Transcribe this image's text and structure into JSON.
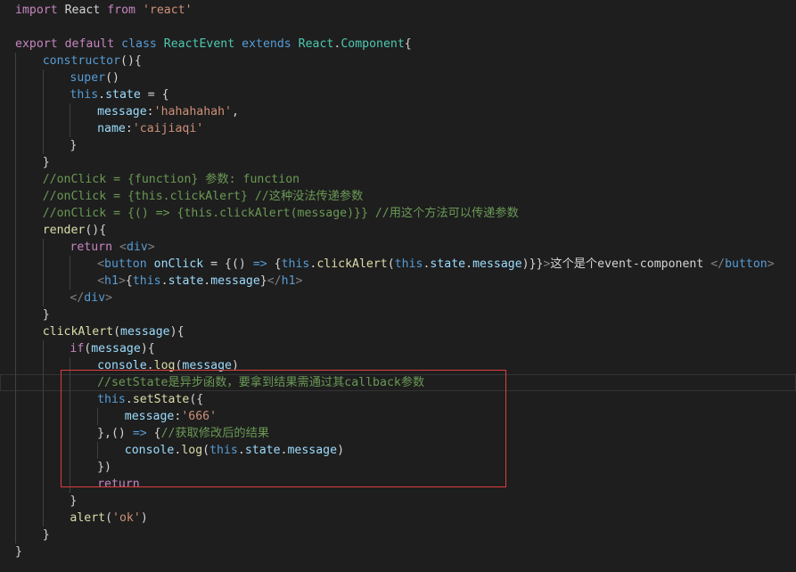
{
  "theme": {
    "background": "#1e1e1e",
    "annotation_color": "#e03c3c"
  },
  "lines": [
    {
      "indent": 0,
      "tokens": [
        {
          "t": "import",
          "c": "kw"
        },
        {
          "t": " React ",
          "c": "plain"
        },
        {
          "t": "from",
          "c": "kw"
        },
        {
          "t": " ",
          "c": "plain"
        },
        {
          "t": "'react'",
          "c": "str"
        }
      ]
    },
    {
      "indent": 0,
      "tokens": []
    },
    {
      "indent": 0,
      "tokens": [
        {
          "t": "export",
          "c": "kw"
        },
        {
          "t": " ",
          "c": "plain"
        },
        {
          "t": "default",
          "c": "kw"
        },
        {
          "t": " ",
          "c": "plain"
        },
        {
          "t": "class",
          "c": "kw2"
        },
        {
          "t": " ",
          "c": "plain"
        },
        {
          "t": "ReactEvent",
          "c": "cls"
        },
        {
          "t": " ",
          "c": "plain"
        },
        {
          "t": "extends",
          "c": "kw2"
        },
        {
          "t": " ",
          "c": "plain"
        },
        {
          "t": "React",
          "c": "cls"
        },
        {
          "t": ".",
          "c": "pun"
        },
        {
          "t": "Component",
          "c": "cls"
        },
        {
          "t": "{",
          "c": "pun"
        }
      ]
    },
    {
      "indent": 1,
      "tokens": [
        {
          "t": "constructor",
          "c": "kw2"
        },
        {
          "t": "(){",
          "c": "pun"
        }
      ]
    },
    {
      "indent": 2,
      "tokens": [
        {
          "t": "super",
          "c": "kw2"
        },
        {
          "t": "()",
          "c": "pun"
        }
      ]
    },
    {
      "indent": 2,
      "tokens": [
        {
          "t": "this",
          "c": "kw2"
        },
        {
          "t": ".",
          "c": "pun"
        },
        {
          "t": "state",
          "c": "var"
        },
        {
          "t": " = {",
          "c": "pun"
        }
      ]
    },
    {
      "indent": 3,
      "tokens": [
        {
          "t": "message",
          "c": "var"
        },
        {
          "t": ":",
          "c": "pun"
        },
        {
          "t": "'hahahahah'",
          "c": "str"
        },
        {
          "t": ",",
          "c": "pun"
        }
      ]
    },
    {
      "indent": 3,
      "tokens": [
        {
          "t": "name",
          "c": "var"
        },
        {
          "t": ":",
          "c": "pun"
        },
        {
          "t": "'caijiaqi'",
          "c": "str"
        }
      ]
    },
    {
      "indent": 2,
      "tokens": [
        {
          "t": "}",
          "c": "pun"
        }
      ]
    },
    {
      "indent": 1,
      "tokens": [
        {
          "t": "}",
          "c": "pun"
        }
      ]
    },
    {
      "indent": 1,
      "tokens": [
        {
          "t": "//onClick = {function} 参数: function",
          "c": "cmt"
        }
      ]
    },
    {
      "indent": 1,
      "tokens": [
        {
          "t": "//onClick = {this.clickAlert} //这种没法传递参数",
          "c": "cmt"
        }
      ]
    },
    {
      "indent": 1,
      "tokens": [
        {
          "t": "//onClick = {() => {this.clickAlert(message)}} //用这个方法可以传递参数",
          "c": "cmt"
        }
      ]
    },
    {
      "indent": 1,
      "tokens": [
        {
          "t": "render",
          "c": "fn"
        },
        {
          "t": "(){",
          "c": "pun"
        }
      ]
    },
    {
      "indent": 2,
      "tokens": [
        {
          "t": "return",
          "c": "kw"
        },
        {
          "t": " ",
          "c": "plain"
        },
        {
          "t": "<",
          "c": "ang"
        },
        {
          "t": "div",
          "c": "tag"
        },
        {
          "t": ">",
          "c": "ang"
        }
      ]
    },
    {
      "indent": 3,
      "tokens": [
        {
          "t": "<",
          "c": "ang"
        },
        {
          "t": "button",
          "c": "tag"
        },
        {
          "t": " ",
          "c": "plain"
        },
        {
          "t": "onClick",
          "c": "var"
        },
        {
          "t": " = {",
          "c": "pun"
        },
        {
          "t": "()",
          "c": "pun"
        },
        {
          "t": " ",
          "c": "plain"
        },
        {
          "t": "=>",
          "c": "kw2"
        },
        {
          "t": " {",
          "c": "pun"
        },
        {
          "t": "this",
          "c": "kw2"
        },
        {
          "t": ".",
          "c": "pun"
        },
        {
          "t": "clickAlert",
          "c": "fn"
        },
        {
          "t": "(",
          "c": "pun"
        },
        {
          "t": "this",
          "c": "kw2"
        },
        {
          "t": ".",
          "c": "pun"
        },
        {
          "t": "state",
          "c": "var"
        },
        {
          "t": ".",
          "c": "pun"
        },
        {
          "t": "message",
          "c": "var"
        },
        {
          "t": ")}}",
          "c": "pun"
        },
        {
          "t": ">",
          "c": "ang"
        },
        {
          "t": "这个是个event-component ",
          "c": "txt"
        },
        {
          "t": "</",
          "c": "ang"
        },
        {
          "t": "button",
          "c": "tag"
        },
        {
          "t": ">",
          "c": "ang"
        }
      ]
    },
    {
      "indent": 3,
      "tokens": [
        {
          "t": "<",
          "c": "ang"
        },
        {
          "t": "h1",
          "c": "tag"
        },
        {
          "t": ">",
          "c": "ang"
        },
        {
          "t": "{",
          "c": "pun"
        },
        {
          "t": "this",
          "c": "kw2"
        },
        {
          "t": ".",
          "c": "pun"
        },
        {
          "t": "state",
          "c": "var"
        },
        {
          "t": ".",
          "c": "pun"
        },
        {
          "t": "message",
          "c": "var"
        },
        {
          "t": "}",
          "c": "pun"
        },
        {
          "t": "</",
          "c": "ang"
        },
        {
          "t": "h1",
          "c": "tag"
        },
        {
          "t": ">",
          "c": "ang"
        }
      ]
    },
    {
      "indent": 2,
      "tokens": [
        {
          "t": "</",
          "c": "ang"
        },
        {
          "t": "div",
          "c": "tag"
        },
        {
          "t": ">",
          "c": "ang"
        }
      ]
    },
    {
      "indent": 1,
      "tokens": [
        {
          "t": "}",
          "c": "pun"
        }
      ]
    },
    {
      "indent": 1,
      "tokens": [
        {
          "t": "clickAlert",
          "c": "fn"
        },
        {
          "t": "(",
          "c": "pun"
        },
        {
          "t": "message",
          "c": "var"
        },
        {
          "t": "){",
          "c": "pun"
        }
      ]
    },
    {
      "indent": 2,
      "tokens": [
        {
          "t": "if",
          "c": "kw"
        },
        {
          "t": "(",
          "c": "pun"
        },
        {
          "t": "message",
          "c": "var"
        },
        {
          "t": "){",
          "c": "pun"
        }
      ]
    },
    {
      "indent": 3,
      "tokens": [
        {
          "t": "console",
          "c": "var"
        },
        {
          "t": ".",
          "c": "pun"
        },
        {
          "t": "log",
          "c": "fn"
        },
        {
          "t": "(",
          "c": "pun"
        },
        {
          "t": "message",
          "c": "var"
        },
        {
          "t": ")",
          "c": "pun"
        }
      ]
    },
    {
      "indent": 3,
      "current": true,
      "tokens": [
        {
          "t": "//setState是异步函数，要拿到结果需通过其callback参数",
          "c": "cmt"
        }
      ]
    },
    {
      "indent": 3,
      "tokens": [
        {
          "t": "this",
          "c": "kw2"
        },
        {
          "t": ".",
          "c": "pun"
        },
        {
          "t": "setState",
          "c": "fn"
        },
        {
          "t": "({",
          "c": "pun"
        }
      ]
    },
    {
      "indent": 4,
      "tokens": [
        {
          "t": "message",
          "c": "var"
        },
        {
          "t": ":",
          "c": "pun"
        },
        {
          "t": "'666'",
          "c": "str"
        }
      ]
    },
    {
      "indent": 3,
      "tokens": [
        {
          "t": "},",
          "c": "pun"
        },
        {
          "t": "()",
          "c": "pun"
        },
        {
          "t": " ",
          "c": "plain"
        },
        {
          "t": "=>",
          "c": "kw2"
        },
        {
          "t": " {",
          "c": "pun"
        },
        {
          "t": "//获取修改后的结果",
          "c": "cmt"
        }
      ]
    },
    {
      "indent": 4,
      "tokens": [
        {
          "t": "console",
          "c": "var"
        },
        {
          "t": ".",
          "c": "pun"
        },
        {
          "t": "log",
          "c": "fn"
        },
        {
          "t": "(",
          "c": "pun"
        },
        {
          "t": "this",
          "c": "kw2"
        },
        {
          "t": ".",
          "c": "pun"
        },
        {
          "t": "state",
          "c": "var"
        },
        {
          "t": ".",
          "c": "pun"
        },
        {
          "t": "message",
          "c": "var"
        },
        {
          "t": ")",
          "c": "pun"
        }
      ]
    },
    {
      "indent": 3,
      "tokens": [
        {
          "t": "})",
          "c": "pun"
        }
      ]
    },
    {
      "indent": 3,
      "tokens": [
        {
          "t": "return",
          "c": "kw"
        }
      ]
    },
    {
      "indent": 2,
      "tokens": [
        {
          "t": "}",
          "c": "pun"
        }
      ]
    },
    {
      "indent": 2,
      "tokens": [
        {
          "t": "alert",
          "c": "fn"
        },
        {
          "t": "(",
          "c": "pun"
        },
        {
          "t": "'ok'",
          "c": "str"
        },
        {
          "t": ")",
          "c": "pun"
        }
      ]
    },
    {
      "indent": 1,
      "tokens": [
        {
          "t": "}",
          "c": "pun"
        }
      ]
    },
    {
      "indent": 0,
      "tokens": [
        {
          "t": "}",
          "c": "pun"
        }
      ]
    }
  ]
}
